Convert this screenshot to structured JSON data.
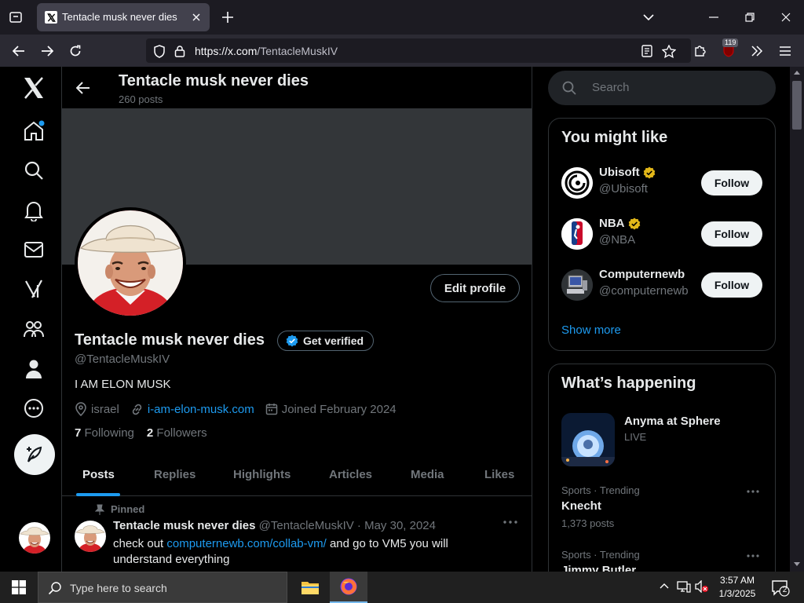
{
  "browser": {
    "tab_title": "Tentacle musk never dies (@TentacleMuskIV) / X",
    "url_host": "https://x.com",
    "url_path": "/TentacleMuskIV",
    "extension_badge": "119"
  },
  "header": {
    "name": "Tentacle musk never dies",
    "post_count": "260 posts"
  },
  "profile": {
    "name": "Tentacle musk never dies",
    "get_verified": "Get verified",
    "handle": "@TentacleMuskIV",
    "bio": "I AM ELON MUSK",
    "location": "israel",
    "link": "i-am-elon-musk.com",
    "joined": "Joined February 2024",
    "following_count": "7",
    "following_label": "Following",
    "followers_count": "2",
    "followers_label": "Followers",
    "edit_profile": "Edit profile"
  },
  "tabs": [
    "Posts",
    "Replies",
    "Highlights",
    "Articles",
    "Media",
    "Likes"
  ],
  "tweet": {
    "pinned_label": "Pinned",
    "name": "Tentacle musk never dies",
    "meta": "@TentacleMuskIV · May 30, 2024",
    "text_before": "check out ",
    "link": "computernewb.com/collab-vm/",
    "text_after": " and go to VM5 you will understand everything"
  },
  "search": {
    "placeholder": "Search"
  },
  "you_might_like": {
    "title": "You might like",
    "suggestions": [
      {
        "name": "Ubisoft",
        "handle": "@Ubisoft",
        "verified": true,
        "button": "Follow"
      },
      {
        "name": "NBA",
        "handle": "@NBA",
        "verified": true,
        "button": "Follow"
      },
      {
        "name": "Computernewb",
        "handle": "@computernewb",
        "verified": false,
        "button": "Follow"
      }
    ],
    "show_more": "Show more"
  },
  "whats_happening": {
    "title": "What’s happening",
    "live": {
      "title": "Anyma at Sphere",
      "status": "LIVE"
    },
    "trends": [
      {
        "context": "Sports · Trending",
        "name": "Knecht",
        "posts": "1,373 posts"
      },
      {
        "context": "Sports · Trending",
        "name": "Jimmy Butler"
      }
    ]
  },
  "taskbar": {
    "search_placeholder": "Type here to search",
    "time": "3:57 AM",
    "date": "1/3/2025",
    "notification_count": "2"
  },
  "colors": {
    "accent": "#1d9bf0",
    "gold_badge": "#e2b719",
    "bg": "#000000"
  }
}
